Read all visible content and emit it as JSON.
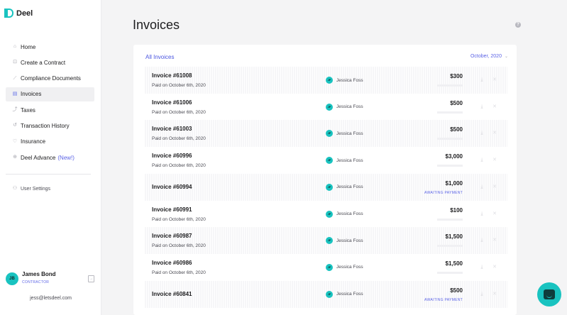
{
  "app": {
    "name": "Deel"
  },
  "sidebar": {
    "items": [
      {
        "label": "Home",
        "icon": "home-icon",
        "glyph": "⌂"
      },
      {
        "label": "Create a Contract",
        "icon": "contract-icon",
        "glyph": "⊡"
      },
      {
        "label": "Compliance Documents",
        "icon": "document-icon",
        "glyph": "⟋"
      },
      {
        "label": "Invoices",
        "icon": "invoice-icon",
        "glyph": "▤",
        "active": true
      },
      {
        "label": "Taxes",
        "icon": "taxes-icon",
        "glyph": "⤴"
      },
      {
        "label": "Transaction History",
        "icon": "history-icon",
        "glyph": "↺"
      },
      {
        "label": "Insurance",
        "icon": "insurance-icon",
        "glyph": "♡"
      },
      {
        "label": "Deel Advance",
        "badge": "(New!)",
        "icon": "advance-icon",
        "glyph": "⊕"
      }
    ],
    "settings_label": "User Settings",
    "user": {
      "initials": "JB",
      "name": "James Bond",
      "role": "CONTRACTOR",
      "email": "jess@letsdeel.com"
    }
  },
  "main": {
    "title": "Invoices",
    "filter_tab": "All Invoices",
    "month": "October, 2020"
  },
  "invoices": [
    {
      "number": "Invoice #61008",
      "paid": "Paid on October 6th, 2020",
      "payer_initials": "JF",
      "payer": "Jessica Foss",
      "amount": "$300",
      "status": ""
    },
    {
      "number": "Invoice #61006",
      "paid": "Paid on October 6th, 2020",
      "payer_initials": "JF",
      "payer": "Jessica Foss",
      "amount": "$500",
      "status": ""
    },
    {
      "number": "Invoice #61003",
      "paid": "Paid on October 6th, 2020",
      "payer_initials": "JF",
      "payer": "Jessica Foss",
      "amount": "$500",
      "status": ""
    },
    {
      "number": "Invoice #60996",
      "paid": "Paid on October 6th, 2020",
      "payer_initials": "JF",
      "payer": "Jessica Foss",
      "amount": "$3,000",
      "status": ""
    },
    {
      "number": "Invoice #60994",
      "paid": "",
      "payer_initials": "JF",
      "payer": "Jessica Foss",
      "amount": "$1,000",
      "status": "AWAITING PAYMENT"
    },
    {
      "number": "Invoice #60991",
      "paid": "Paid on October 6th, 2020",
      "payer_initials": "JF",
      "payer": "Jessica Foss",
      "amount": "$100",
      "status": ""
    },
    {
      "number": "Invoice #60987",
      "paid": "Paid on October 6th, 2020",
      "payer_initials": "JF",
      "payer": "Jessica Foss",
      "amount": "$1,500",
      "status": ""
    },
    {
      "number": "Invoice #60986",
      "paid": "Paid on October 6th, 2020",
      "payer_initials": "JF",
      "payer": "Jessica Foss",
      "amount": "$1,500",
      "status": ""
    },
    {
      "number": "Invoice #60841",
      "paid": "",
      "payer_initials": "JF",
      "payer": "Jessica Foss",
      "amount": "$500",
      "status": "AWAITING PAYMENT"
    }
  ],
  "colors": {
    "accent": "#19c3c0",
    "link": "#4a55e0",
    "status": "#5b63e6"
  }
}
